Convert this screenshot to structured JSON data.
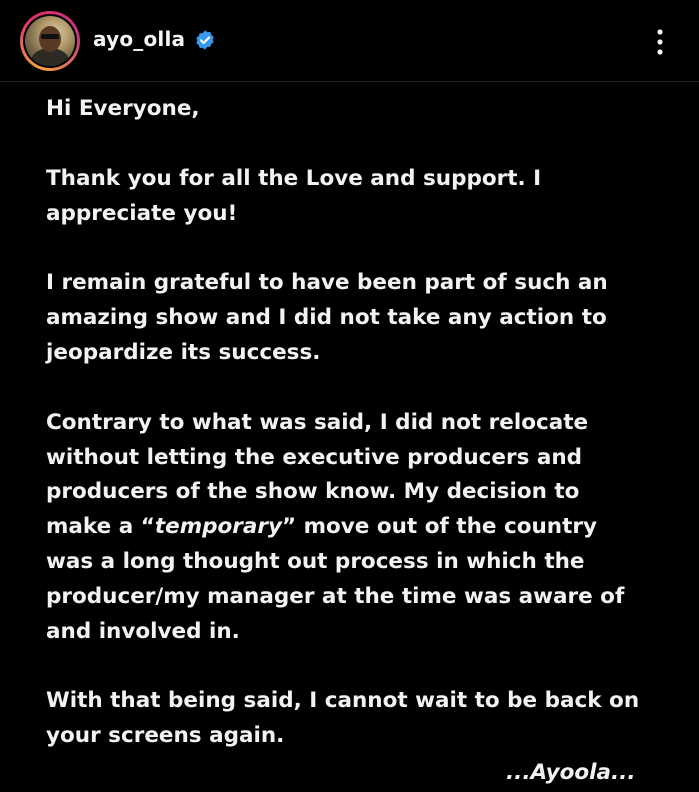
{
  "header": {
    "username": "ayo_olla",
    "verified_color": "#3897f0",
    "avatar_icon": "profile-photo",
    "more_icon": "more-vertical-icon"
  },
  "post": {
    "greeting": "Hi Everyone,",
    "thanks_line1": "Thank you for all the Love and support. I",
    "thanks_line2": "appreciate you!",
    "grateful_line1": "I remain grateful to have been part of such an",
    "grateful_line2": "amazing show and I did not take any action to",
    "grateful_line3": "jeopardize its success.",
    "contrary_line1": "Contrary to what was said, I did not relocate",
    "contrary_line2": "without letting the executive producers and",
    "contrary_line3": "producers of the show know. My decision to",
    "contrary_line4_pre": "make a “",
    "contrary_line4_italic": "temporary",
    "contrary_line4_post": "” move out of the country",
    "contrary_line5": "was a long thought out process in which the",
    "contrary_line6": "producer/my manager at the time was aware of",
    "contrary_line7": "and involved in.",
    "closing_line1": "With that being said, I cannot wait to be back on",
    "closing_line2": "your screens again.",
    "signoff": "...Ayoola..."
  }
}
